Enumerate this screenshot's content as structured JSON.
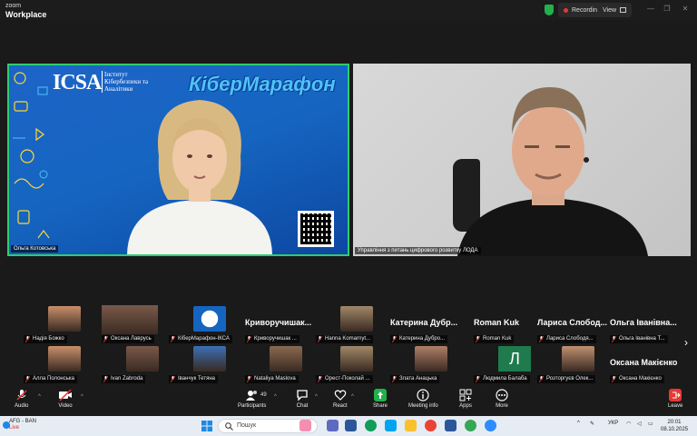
{
  "app": {
    "logo_line1": "zoom",
    "logo_line2": "Workplace"
  },
  "header": {
    "recording_label": "Recording",
    "view_label": "View"
  },
  "main_videos": [
    {
      "name": "Ольга Котовська",
      "banner_logo": "ICSA",
      "banner_logo_subtitle": "Інститут Кібербезпеки та Аналітики",
      "banner_title": "КіберМарафон"
    },
    {
      "name": "Управління з питань цифрового розвитку ЛОДА"
    }
  ],
  "gallery": [
    {
      "label": "Надія Божко",
      "kind": "photo"
    },
    {
      "label": "Оксана Лаврусь",
      "kind": "photo"
    },
    {
      "label": "КіберМарафон-ІКСА",
      "kind": "logo"
    },
    {
      "label": "Криворучишак ...",
      "big_name": "Криворучишак...",
      "kind": "name"
    },
    {
      "label": "Hanna Komarnyt...",
      "kind": "photo"
    },
    {
      "label": "Катерина Дубро...",
      "big_name": "Катерина Дубр...",
      "kind": "name"
    },
    {
      "label": "Roman Kuk",
      "big_name": "Roman Kuk",
      "kind": "name"
    },
    {
      "label": "Лариса Слободя...",
      "big_name": "Лариса Слобод...",
      "kind": "name"
    },
    {
      "label": "Ольга Іванівна Т...",
      "big_name": "Ольга Іванівна...",
      "kind": "name"
    },
    {
      "label": "Алла Полонська",
      "kind": "photo"
    },
    {
      "label": "Ivan Zabroda",
      "kind": "photo"
    },
    {
      "label": "Іванчук Тетяна",
      "kind": "photo"
    },
    {
      "label": "Nataliya Maslova",
      "kind": "photo"
    },
    {
      "label": "Орест-Поколай ...",
      "kind": "photo"
    },
    {
      "label": "Злата Анацька",
      "kind": "photo"
    },
    {
      "label": "Людмила Балаба",
      "kind": "letter",
      "letter": "Л"
    },
    {
      "label": "Розторгуєв Олек...",
      "kind": "photo"
    },
    {
      "label": "Оксана Макієнко",
      "big_name": "Оксана Макієнко",
      "kind": "name"
    }
  ],
  "toolbar": {
    "audio": "Audio",
    "video": "Video",
    "participants": "Participants",
    "participants_count": "49",
    "chat": "Chat",
    "react": "React",
    "share": "Share",
    "meeting_info": "Meeting info",
    "apps": "Apps",
    "more": "More",
    "leave": "Leave"
  },
  "taskbar": {
    "weather_line1": "AFG - BAN",
    "weather_line2": "Live",
    "search_placeholder": "Пошук",
    "language": "УКР",
    "time": "20:01",
    "date": "08.10.2025"
  },
  "colors": {
    "active_speaker_border": "#2ecc71",
    "share_green": "#22b14c",
    "leave_red": "#e53935",
    "recording_dot": "#e53935"
  }
}
